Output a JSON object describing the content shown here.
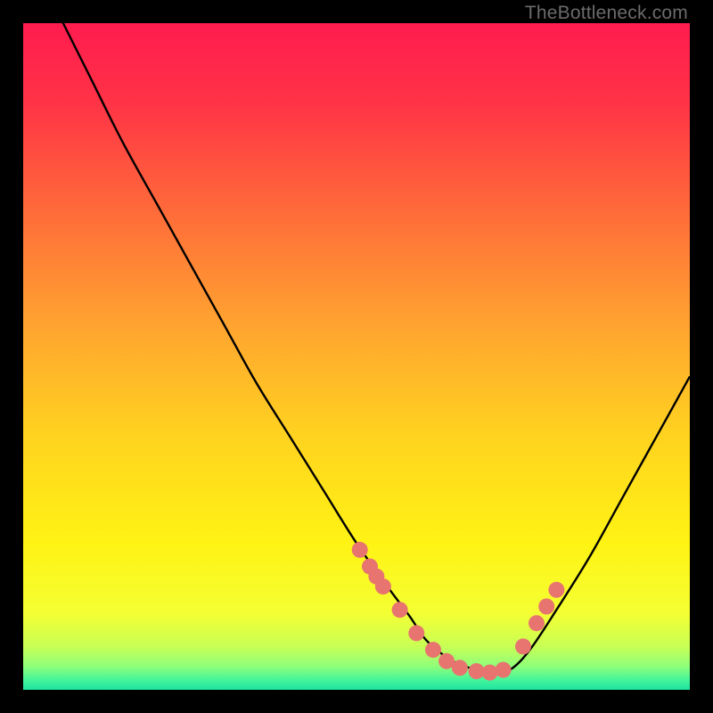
{
  "watermark": "TheBottleneck.com",
  "colors": {
    "background_black": "#000000",
    "curve_stroke": "#000000",
    "marker_fill": "#e8746f",
    "watermark_text": "#6b6b6b"
  },
  "chart_data": {
    "type": "line",
    "title": "",
    "xlabel": "",
    "ylabel": "",
    "xlim": [
      0,
      100
    ],
    "ylim": [
      0,
      100
    ],
    "gradient_stops": [
      {
        "offset": 0.0,
        "color": "#ff1c4f"
      },
      {
        "offset": 0.12,
        "color": "#ff3346"
      },
      {
        "offset": 0.28,
        "color": "#ff6a3a"
      },
      {
        "offset": 0.45,
        "color": "#ffa330"
      },
      {
        "offset": 0.62,
        "color": "#ffd31f"
      },
      {
        "offset": 0.78,
        "color": "#fff314"
      },
      {
        "offset": 0.885,
        "color": "#f4ff33"
      },
      {
        "offset": 0.935,
        "color": "#c8ff55"
      },
      {
        "offset": 0.965,
        "color": "#8eff7a"
      },
      {
        "offset": 0.985,
        "color": "#45f59a"
      },
      {
        "offset": 1.0,
        "color": "#1ee3a0"
      }
    ],
    "series": [
      {
        "name": "bottleneck-curve",
        "x": [
          5,
          10,
          15,
          20,
          25,
          30,
          35,
          40,
          45,
          50,
          55,
          58,
          60,
          62,
          65,
          68,
          70,
          73,
          76,
          80,
          85,
          90,
          95,
          100
        ],
        "values": [
          102,
          92,
          82,
          73,
          64,
          55,
          46,
          38,
          30,
          22,
          15,
          11,
          8,
          6,
          4,
          3,
          2.5,
          3,
          6,
          12,
          20,
          29,
          38,
          47
        ]
      }
    ],
    "markers": {
      "name": "highlighted-points",
      "x": [
        50.5,
        52.0,
        53.0,
        54.0,
        56.5,
        59.0,
        61.5,
        63.5,
        65.5,
        68.0,
        70.0,
        72.0,
        75.0,
        77.0,
        78.5,
        80.0
      ],
      "values": [
        21.0,
        18.5,
        17.0,
        15.5,
        12.0,
        8.5,
        6.0,
        4.3,
        3.3,
        2.8,
        2.6,
        3.0,
        6.5,
        10.0,
        12.5,
        15.0
      ]
    }
  }
}
